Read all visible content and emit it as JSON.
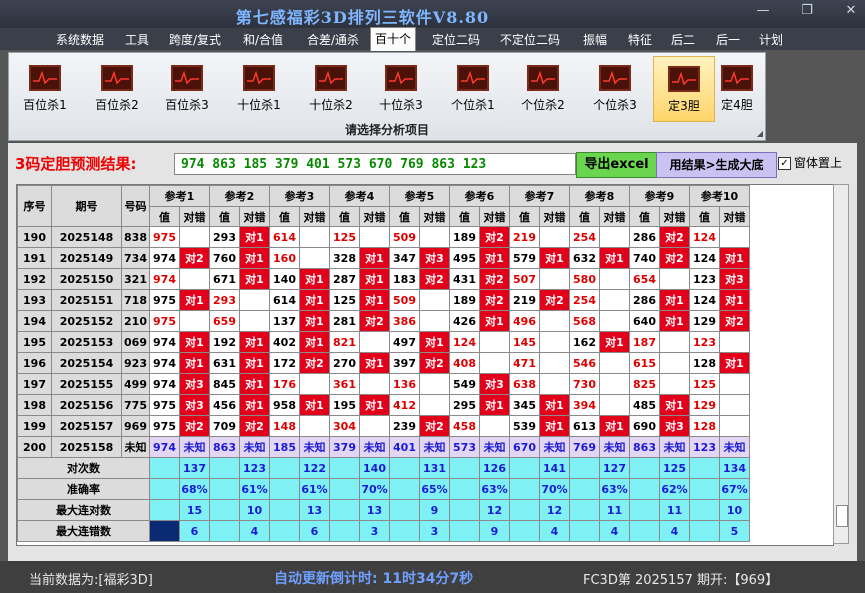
{
  "window": {
    "title": "第七感福彩3D排列三软件V8.80"
  },
  "menu": [
    "系统数据",
    "工具",
    "跨度/复式",
    "和/合值",
    "合差/通杀",
    "百十个",
    "定位二码",
    "不定位二码",
    "振幅",
    "特征",
    "后二",
    "后一",
    "计划"
  ],
  "ribbon": {
    "buttons": [
      "百位杀1",
      "百位杀2",
      "百位杀3",
      "十位杀1",
      "十位杀2",
      "十位杀3",
      "个位杀1",
      "个位杀2",
      "个位杀3",
      "定3胆",
      "定4胆"
    ],
    "caption": "请选择分析项目"
  },
  "prediction": {
    "label": "3码定胆预测结果:",
    "value": "974 863 185 379 401 573 670 769 863 123",
    "export_label": "导出excel",
    "big_label": "用结果>生成大底",
    "topmost_label": "窗体置上"
  },
  "grid": {
    "headers": {
      "seq": "序号",
      "period": "期号",
      "number": "号码",
      "value": "值",
      "result": "对错"
    },
    "refs": [
      "参考1",
      "参考2",
      "参考3",
      "参考4",
      "参考5",
      "参考6",
      "参考7",
      "参考8",
      "参考9",
      "参考10"
    ],
    "rows": [
      {
        "seq": "190",
        "period": "2025148",
        "num": "838",
        "cells": [
          [
            "975",
            ""
          ],
          [
            "293",
            "对1"
          ],
          [
            "614",
            ""
          ],
          [
            "125",
            ""
          ],
          [
            "509",
            ""
          ],
          [
            "189",
            "对2"
          ],
          [
            "219",
            ""
          ],
          [
            "254",
            ""
          ],
          [
            "286",
            "对2"
          ],
          [
            "124",
            ""
          ]
        ]
      },
      {
        "seq": "191",
        "period": "2025149",
        "num": "734",
        "cells": [
          [
            "974",
            "对2"
          ],
          [
            "760",
            "对1"
          ],
          [
            "160",
            ""
          ],
          [
            "328",
            "对1"
          ],
          [
            "347",
            "对3"
          ],
          [
            "495",
            "对1"
          ],
          [
            "579",
            "对1"
          ],
          [
            "632",
            "对1"
          ],
          [
            "740",
            "对2"
          ],
          [
            "124",
            "对1"
          ]
        ]
      },
      {
        "seq": "192",
        "period": "2025150",
        "num": "321",
        "cells": [
          [
            "974",
            ""
          ],
          [
            "671",
            "对1"
          ],
          [
            "140",
            "对1"
          ],
          [
            "287",
            "对1"
          ],
          [
            "183",
            "对2"
          ],
          [
            "431",
            "对2"
          ],
          [
            "507",
            ""
          ],
          [
            "580",
            ""
          ],
          [
            "654",
            ""
          ],
          [
            "123",
            "对3"
          ]
        ]
      },
      {
        "seq": "193",
        "period": "2025151",
        "num": "718",
        "cells": [
          [
            "975",
            "对1"
          ],
          [
            "293",
            ""
          ],
          [
            "614",
            "对1"
          ],
          [
            "125",
            "对1"
          ],
          [
            "509",
            ""
          ],
          [
            "189",
            "对2"
          ],
          [
            "219",
            "对2"
          ],
          [
            "254",
            ""
          ],
          [
            "286",
            "对1"
          ],
          [
            "124",
            "对1"
          ]
        ]
      },
      {
        "seq": "194",
        "period": "2025152",
        "num": "210",
        "cells": [
          [
            "975",
            ""
          ],
          [
            "659",
            ""
          ],
          [
            "137",
            "对1"
          ],
          [
            "281",
            "对2"
          ],
          [
            "386",
            ""
          ],
          [
            "426",
            "对1"
          ],
          [
            "496",
            ""
          ],
          [
            "568",
            ""
          ],
          [
            "640",
            "对1"
          ],
          [
            "129",
            "对2"
          ]
        ]
      },
      {
        "seq": "195",
        "period": "2025153",
        "num": "069",
        "cells": [
          [
            "974",
            "对1"
          ],
          [
            "192",
            "对1"
          ],
          [
            "402",
            "对1"
          ],
          [
            "821",
            ""
          ],
          [
            "497",
            "对1"
          ],
          [
            "124",
            ""
          ],
          [
            "145",
            ""
          ],
          [
            "162",
            "对1"
          ],
          [
            "187",
            ""
          ],
          [
            "123",
            ""
          ]
        ]
      },
      {
        "seq": "196",
        "period": "2025154",
        "num": "923",
        "cells": [
          [
            "974",
            "对1"
          ],
          [
            "631",
            "对1"
          ],
          [
            "172",
            "对2"
          ],
          [
            "270",
            "对1"
          ],
          [
            "397",
            "对2"
          ],
          [
            "408",
            ""
          ],
          [
            "471",
            ""
          ],
          [
            "546",
            ""
          ],
          [
            "615",
            ""
          ],
          [
            "128",
            "对1"
          ]
        ]
      },
      {
        "seq": "197",
        "period": "2025155",
        "num": "499",
        "cells": [
          [
            "974",
            "对3"
          ],
          [
            "845",
            "对1"
          ],
          [
            "176",
            ""
          ],
          [
            "361",
            ""
          ],
          [
            "136",
            ""
          ],
          [
            "549",
            "对3"
          ],
          [
            "638",
            ""
          ],
          [
            "730",
            ""
          ],
          [
            "825",
            ""
          ],
          [
            "125",
            ""
          ]
        ]
      },
      {
        "seq": "198",
        "period": "2025156",
        "num": "775",
        "cells": [
          [
            "975",
            "对3"
          ],
          [
            "456",
            "对1"
          ],
          [
            "958",
            "对1"
          ],
          [
            "195",
            "对1"
          ],
          [
            "412",
            ""
          ],
          [
            "295",
            "对1"
          ],
          [
            "345",
            "对1"
          ],
          [
            "394",
            ""
          ],
          [
            "485",
            "对1"
          ],
          [
            "129",
            ""
          ]
        ]
      },
      {
        "seq": "199",
        "period": "2025157",
        "num": "969",
        "cells": [
          [
            "975",
            "对2"
          ],
          [
            "709",
            "对2"
          ],
          [
            "148",
            ""
          ],
          [
            "304",
            ""
          ],
          [
            "239",
            "对2"
          ],
          [
            "458",
            ""
          ],
          [
            "539",
            "对1"
          ],
          [
            "613",
            "对1"
          ],
          [
            "690",
            "对3"
          ],
          [
            "128",
            ""
          ]
        ]
      }
    ],
    "predict_row": {
      "seq": "200",
      "period": "2025158",
      "num": "未知",
      "unknown": "未知",
      "values": [
        "974",
        "863",
        "185",
        "379",
        "401",
        "573",
        "670",
        "769",
        "863",
        "123"
      ]
    },
    "stats": [
      {
        "label": "对次数",
        "values": [
          "137",
          "123",
          "122",
          "140",
          "131",
          "126",
          "141",
          "127",
          "125",
          "134"
        ]
      },
      {
        "label": "准确率",
        "values": [
          "68%",
          "61%",
          "61%",
          "70%",
          "65%",
          "63%",
          "70%",
          "63%",
          "62%",
          "67%"
        ]
      },
      {
        "label": "最大连对数",
        "values": [
          "15",
          "10",
          "13",
          "13",
          "9",
          "12",
          "12",
          "11",
          "11",
          "10"
        ]
      },
      {
        "label": "最大连错数",
        "values": [
          "6",
          "4",
          "6",
          "3",
          "3",
          "9",
          "4",
          "4",
          "4",
          "5"
        ]
      }
    ]
  },
  "status": {
    "current_data": "当前数据为:[福彩3D]",
    "countdown": "自动更新倒计时: 11时34分7秒",
    "period_info": "FC3D第 2025157 期开:【969】"
  }
}
